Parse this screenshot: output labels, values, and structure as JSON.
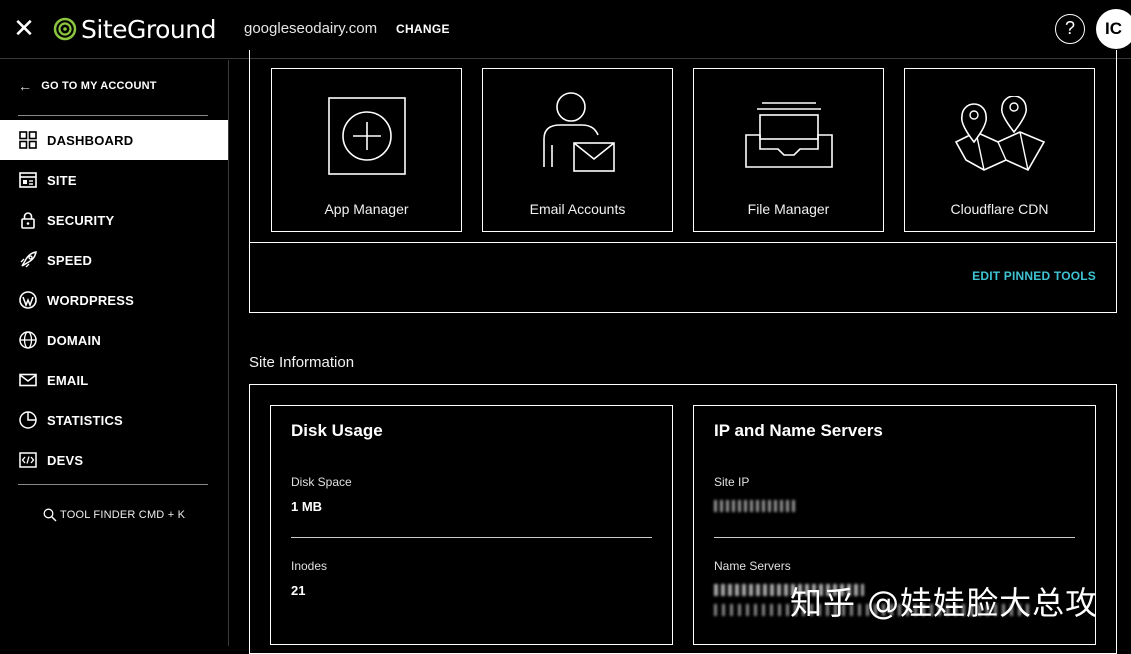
{
  "header": {
    "logo_text": "SiteGround",
    "domain": "googleseodairy.com",
    "change_label": "CHANGE",
    "help_label": "?",
    "avatar_initials": "IC"
  },
  "sidebar": {
    "back_label": "GO TO MY ACCOUNT",
    "items": [
      {
        "label": "DASHBOARD",
        "icon": "grid-icon"
      },
      {
        "label": "SITE",
        "icon": "site-icon"
      },
      {
        "label": "SECURITY",
        "icon": "lock-icon"
      },
      {
        "label": "SPEED",
        "icon": "rocket-icon"
      },
      {
        "label": "WORDPRESS",
        "icon": "wordpress-icon"
      },
      {
        "label": "DOMAIN",
        "icon": "globe-icon"
      },
      {
        "label": "EMAIL",
        "icon": "envelope-icon"
      },
      {
        "label": "STATISTICS",
        "icon": "pie-chart-icon"
      },
      {
        "label": "DEVS",
        "icon": "code-icon"
      }
    ],
    "tool_finder": "TOOL FINDER CMD + K"
  },
  "pinned_tools": {
    "tools": [
      {
        "label": "App Manager",
        "icon": "plus-box-icon"
      },
      {
        "label": "Email Accounts",
        "icon": "user-mail-icon"
      },
      {
        "label": "File Manager",
        "icon": "tray-icon"
      },
      {
        "label": "Cloudflare CDN",
        "icon": "map-pins-icon"
      }
    ],
    "edit_label": "EDIT PINNED TOOLS"
  },
  "site_info": {
    "title": "Site Information",
    "disk": {
      "title": "Disk Usage",
      "disk_space_label": "Disk Space",
      "disk_space_value": "1 MB",
      "inodes_label": "Inodes",
      "inodes_value": "21"
    },
    "servers": {
      "title": "IP and Name Servers",
      "site_ip_label": "Site IP",
      "name_servers_label": "Name Servers"
    }
  },
  "watermark": "知乎 @娃娃脸大总攻"
}
